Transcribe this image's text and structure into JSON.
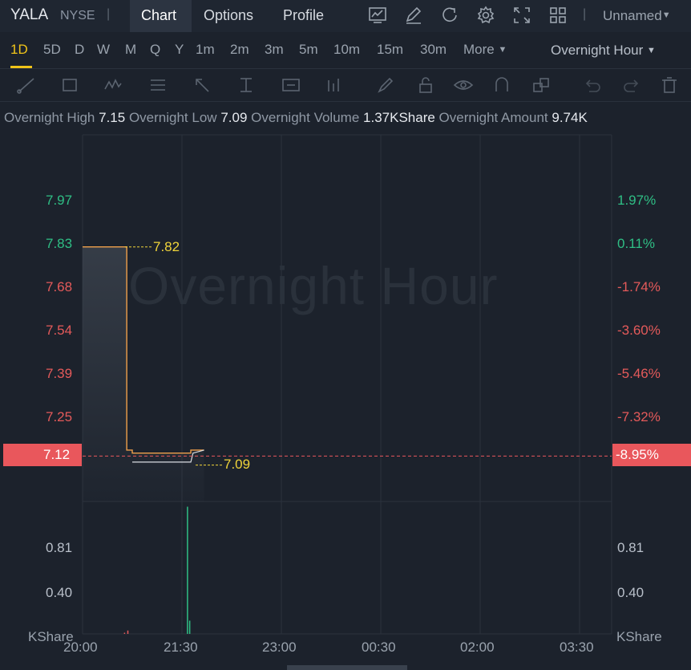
{
  "header": {
    "ticker": "YALA",
    "exchange": "NYSE",
    "separator": "|",
    "tabs": [
      {
        "label": "Chart",
        "active": true
      },
      {
        "label": "Options",
        "active": false
      },
      {
        "label": "Profile",
        "active": false
      }
    ],
    "icons": [
      "indicator-chart-icon",
      "edit-pen-icon",
      "refresh-icon",
      "settings-gear-icon",
      "fullscreen-icon",
      "layout-grid-icon"
    ],
    "workspace_label": "Unnamed"
  },
  "periods": {
    "items": [
      "1D",
      "5D",
      "D",
      "W",
      "M",
      "Q",
      "Y",
      "1m",
      "2m",
      "3m",
      "5m",
      "10m",
      "15m",
      "30m",
      "More"
    ],
    "active": "1D",
    "session_selector": "Overnight Hour"
  },
  "drawing_tools": [
    "trend-line-icon",
    "rectangle-icon",
    "wave-pattern-icon",
    "fibonacci-icon",
    "arrow-icon",
    "price-range-icon",
    "text-note-icon",
    "bar-pattern-icon",
    "brush-icon",
    "lock-icon",
    "eye-icon",
    "magnet-icon",
    "group-icon",
    "undo-icon",
    "redo-icon",
    "trash-icon"
  ],
  "stats": {
    "high_label": "Overnight High",
    "high_value": "7.15",
    "low_label": "Overnight Low",
    "low_value": "7.09",
    "volume_label": "Overnight Volume",
    "volume_value": "1.37KShare",
    "amount_label": "Overnight Amount",
    "amount_value": "9.74K"
  },
  "chart_data": {
    "type": "line",
    "watermark": "Overnight Hour",
    "colors": {
      "line": "#f0a04b",
      "up": "#2fbf85",
      "down": "#e45a5a",
      "current_price_bg": "#e9575c",
      "hilo_marker": "#f0d43a"
    },
    "price_axis_left": [
      {
        "value": "7.97",
        "color": "green"
      },
      {
        "value": "7.83",
        "color": "green"
      },
      {
        "value": "7.68",
        "color": "red"
      },
      {
        "value": "7.54",
        "color": "red"
      },
      {
        "value": "7.39",
        "color": "red"
      },
      {
        "value": "7.25",
        "color": "red"
      }
    ],
    "percent_axis_right": [
      "1.97%",
      "0.11%",
      "-1.74%",
      "-3.60%",
      "-5.46%",
      "-7.32%"
    ],
    "current_price": "7.12",
    "current_percent": "-8.95%",
    "high_marker": "7.82",
    "low_marker": "7.09",
    "x_ticks": [
      "20:00",
      "21:30",
      "23:00",
      "00:30",
      "02:00",
      "03:30"
    ],
    "price_series": {
      "x": [
        "20:00",
        "20:37",
        "20:40",
        "20:45",
        "21:00",
        "21:30",
        "21:38",
        "21:50"
      ],
      "y": [
        7.82,
        7.82,
        7.14,
        7.13,
        7.13,
        7.13,
        7.14,
        7.14
      ]
    },
    "avg_series": {
      "x": [
        "20:45",
        "21:38",
        "21:40",
        "21:50"
      ],
      "y": [
        7.1,
        7.1,
        7.13,
        7.14
      ]
    },
    "volume_axis": [
      "0.81",
      "0.40"
    ],
    "volume_unit": "KShare",
    "volume_bars": [
      {
        "x": "20:38",
        "value": 0.03,
        "dir": "down"
      },
      {
        "x": "20:41",
        "value": 0.05,
        "dir": "down"
      },
      {
        "x": "21:35",
        "value": 1.18,
        "dir": "up"
      },
      {
        "x": "21:37",
        "value": 0.14,
        "dir": "up"
      }
    ]
  }
}
